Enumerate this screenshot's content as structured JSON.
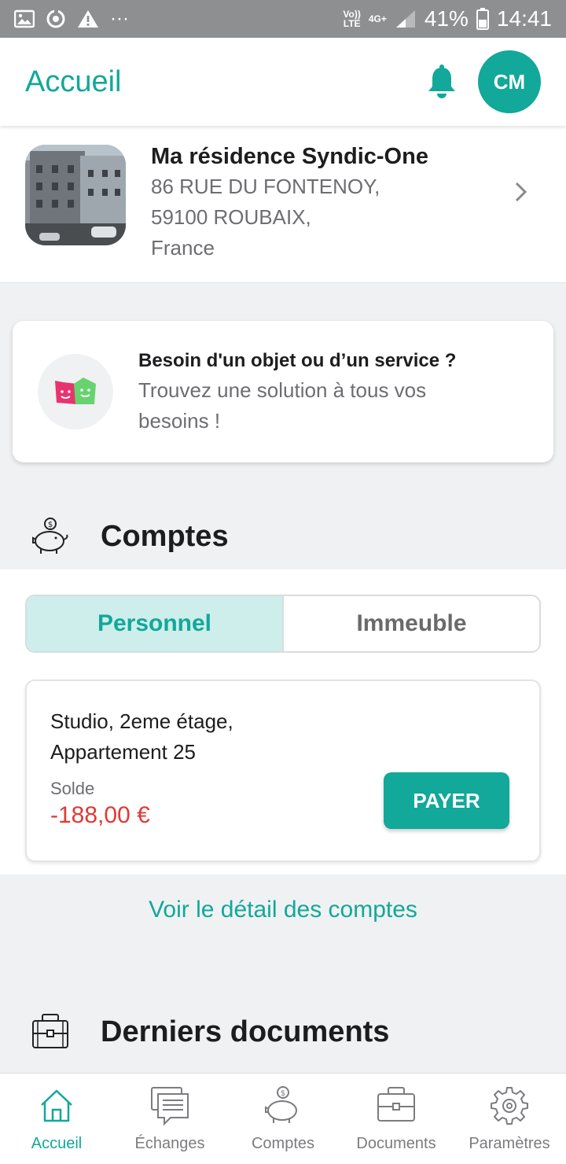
{
  "status_bar": {
    "network_top": "Vo))",
    "network_bottom": "LTE",
    "signal_label": "4G+",
    "battery_pct": "41%",
    "time": "14:41"
  },
  "header": {
    "title": "Accueil",
    "avatar_initials": "CM"
  },
  "residence": {
    "name": "Ma résidence Syndic-One",
    "address_line1": "86 RUE DU FONTENOY,",
    "address_line2": "59100 ROUBAIX,",
    "address_line3": "France"
  },
  "promo": {
    "title": "Besoin d'un objet ou d’un service ?",
    "subtitle_line1": "Trouvez une solution à tous vos",
    "subtitle_line2": "besoins !"
  },
  "comptes": {
    "section_title": "Comptes",
    "tabs": [
      {
        "label": "Personnel",
        "active": true
      },
      {
        "label": "Immeuble",
        "active": false
      }
    ],
    "lot": {
      "name_line1": "Studio, 2eme étage,",
      "name_line2": "Appartement 25",
      "solde_label": "Solde",
      "solde_value": "-188,00 €",
      "pay_label": "PAYER"
    },
    "detail_link": "Voir le détail des comptes"
  },
  "documents": {
    "section_title": "Derniers documents"
  },
  "bottom_nav": {
    "items": [
      {
        "label": "Accueil",
        "icon": "home-icon",
        "active": true
      },
      {
        "label": "Échanges",
        "icon": "chat-icon",
        "active": false
      },
      {
        "label": "Comptes",
        "icon": "piggy-bank-icon",
        "active": false
      },
      {
        "label": "Documents",
        "icon": "briefcase-icon",
        "active": false
      },
      {
        "label": "Paramètres",
        "icon": "gear-icon",
        "active": false
      }
    ]
  },
  "colors": {
    "accent": "#12a89a",
    "accent_light": "#cdeeea",
    "negative": "#e03a35",
    "background": "#f0f1f3"
  }
}
